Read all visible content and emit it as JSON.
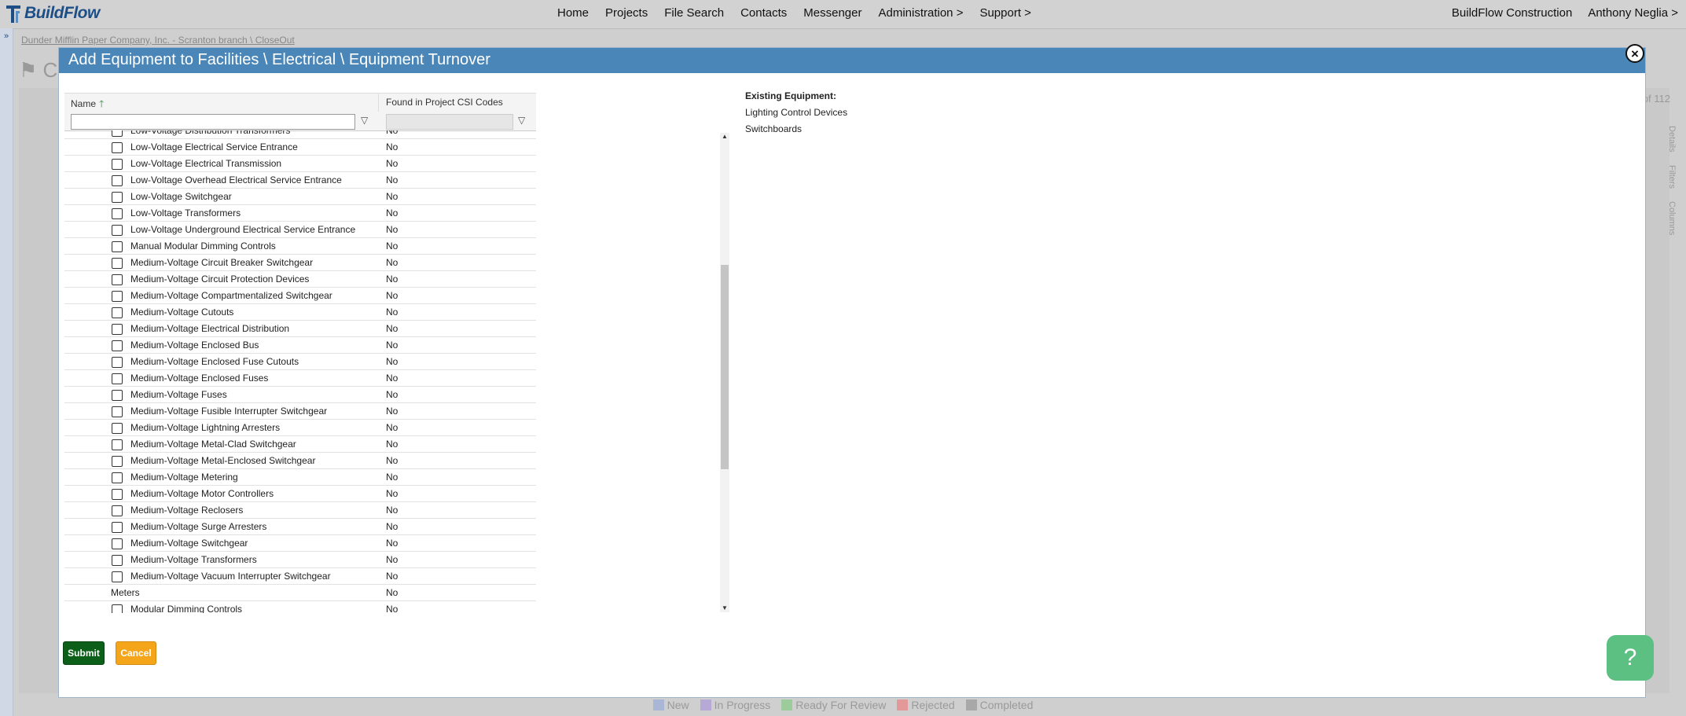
{
  "app": {
    "logo_text": "BuildFlow",
    "nav": [
      "Home",
      "Projects",
      "File Search",
      "Contacts",
      "Messenger",
      "Administration >",
      "Support >"
    ],
    "company": "BuildFlow Construction",
    "user": "Anthony Neglia >"
  },
  "background": {
    "breadcrumb": "Dunder Mifflin Paper Company, Inc. - Scranton branch \\ CloseOut",
    "title": "C",
    "pager": "of 112",
    "right_tabs": [
      "Details",
      "Filters",
      "Columns"
    ],
    "legend": [
      {
        "label": "New",
        "color": "#a9b6d6"
      },
      {
        "label": "In Progress",
        "color": "#b6a9d6"
      },
      {
        "label": "Ready For Review",
        "color": "#9ccc9c"
      },
      {
        "label": "Rejected",
        "color": "#e39999"
      },
      {
        "label": "Completed",
        "color": "#a8a8a8"
      }
    ]
  },
  "modal": {
    "title": "Add Equipment to Facilities \\ Electrical \\ Equipment Turnover",
    "close_label": "×",
    "grid": {
      "col_name": "Name",
      "col_found": "Found in Project CSI Codes",
      "rows": [
        {
          "name": "Low-Voltage Distribution Transformers",
          "found": "No",
          "checkbox": true
        },
        {
          "name": "Low-Voltage Electrical Service Entrance",
          "found": "No",
          "checkbox": true
        },
        {
          "name": "Low-Voltage Electrical Transmission",
          "found": "No",
          "checkbox": true
        },
        {
          "name": "Low-Voltage Overhead Electrical Service Entrance",
          "found": "No",
          "checkbox": true
        },
        {
          "name": "Low-Voltage Switchgear",
          "found": "No",
          "checkbox": true
        },
        {
          "name": "Low-Voltage Transformers",
          "found": "No",
          "checkbox": true
        },
        {
          "name": "Low-Voltage Underground Electrical Service Entrance",
          "found": "No",
          "checkbox": true
        },
        {
          "name": "Manual Modular Dimming Controls",
          "found": "No",
          "checkbox": true
        },
        {
          "name": "Medium-Voltage Circuit Breaker Switchgear",
          "found": "No",
          "checkbox": true
        },
        {
          "name": "Medium-Voltage Circuit Protection Devices",
          "found": "No",
          "checkbox": true
        },
        {
          "name": "Medium-Voltage Compartmentalized Switchgear",
          "found": "No",
          "checkbox": true
        },
        {
          "name": "Medium-Voltage Cutouts",
          "found": "No",
          "checkbox": true
        },
        {
          "name": "Medium-Voltage Electrical Distribution",
          "found": "No",
          "checkbox": true
        },
        {
          "name": "Medium-Voltage Enclosed Bus",
          "found": "No",
          "checkbox": true
        },
        {
          "name": "Medium-Voltage Enclosed Fuse Cutouts",
          "found": "No",
          "checkbox": true
        },
        {
          "name": "Medium-Voltage Enclosed Fuses",
          "found": "No",
          "checkbox": true
        },
        {
          "name": "Medium-Voltage Fuses",
          "found": "No",
          "checkbox": true
        },
        {
          "name": "Medium-Voltage Fusible Interrupter Switchgear",
          "found": "No",
          "checkbox": true
        },
        {
          "name": "Medium-Voltage Lightning Arresters",
          "found": "No",
          "checkbox": true
        },
        {
          "name": "Medium-Voltage Metal-Clad Switchgear",
          "found": "No",
          "checkbox": true
        },
        {
          "name": "Medium-Voltage Metal-Enclosed Switchgear",
          "found": "No",
          "checkbox": true
        },
        {
          "name": "Medium-Voltage Metering",
          "found": "No",
          "checkbox": true
        },
        {
          "name": "Medium-Voltage Motor Controllers",
          "found": "No",
          "checkbox": true
        },
        {
          "name": "Medium-Voltage Reclosers",
          "found": "No",
          "checkbox": true
        },
        {
          "name": "Medium-Voltage Surge Arresters",
          "found": "No",
          "checkbox": true
        },
        {
          "name": "Medium-Voltage Switchgear",
          "found": "No",
          "checkbox": true
        },
        {
          "name": "Medium-Voltage Transformers",
          "found": "No",
          "checkbox": true
        },
        {
          "name": "Medium-Voltage Vacuum Interrupter Switchgear",
          "found": "No",
          "checkbox": true
        },
        {
          "name": "Meters",
          "found": "No",
          "checkbox": false
        },
        {
          "name": "Modular Dimming Controls",
          "found": "No",
          "checkbox": true
        }
      ]
    },
    "existing": {
      "title": "Existing Equipment:",
      "items": [
        "Lighting Control Devices",
        "Switchboards"
      ]
    },
    "submit_label": "Submit",
    "cancel_label": "Cancel"
  },
  "help_label": "?"
}
